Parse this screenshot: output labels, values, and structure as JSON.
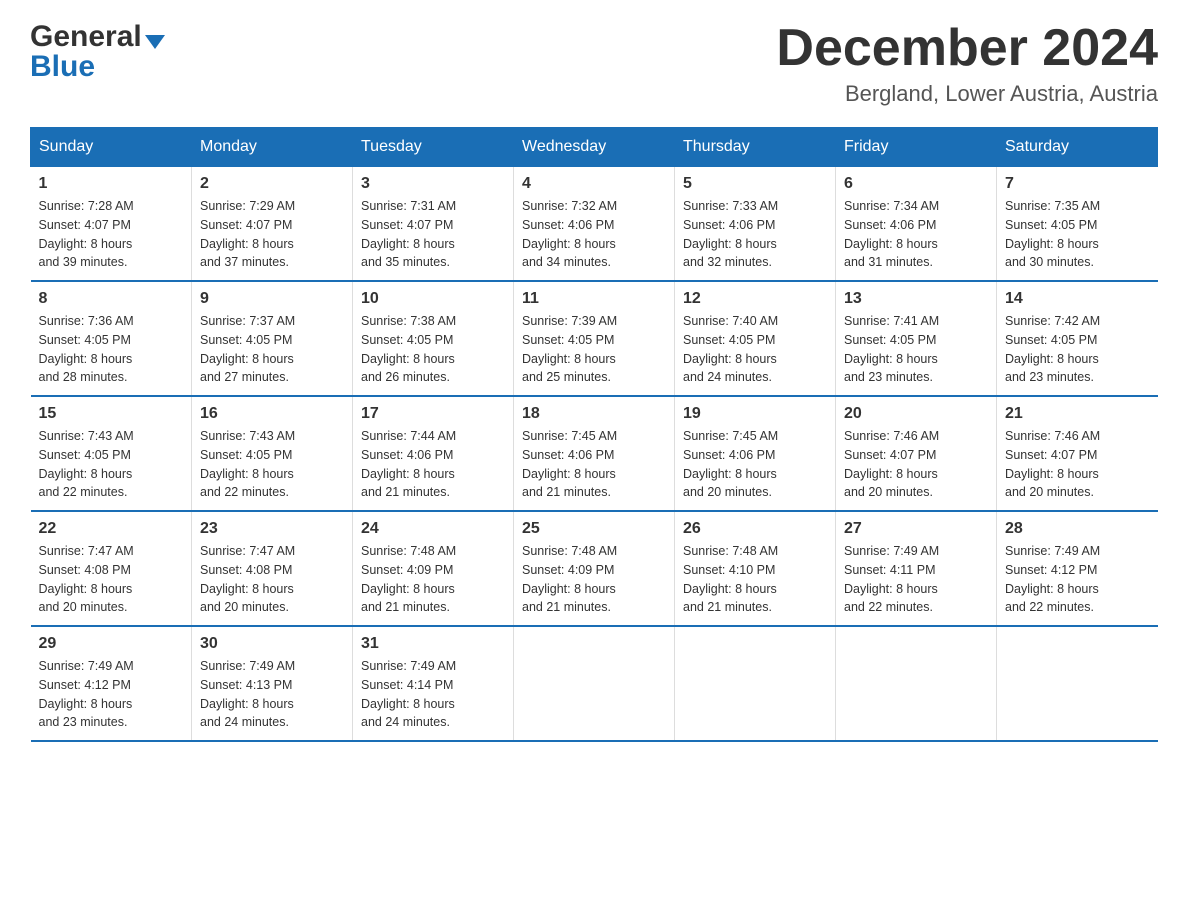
{
  "header": {
    "logo_top": "General",
    "logo_bottom": "Blue",
    "month_title": "December 2024",
    "location": "Bergland, Lower Austria, Austria"
  },
  "days_of_week": [
    "Sunday",
    "Monday",
    "Tuesday",
    "Wednesday",
    "Thursday",
    "Friday",
    "Saturday"
  ],
  "weeks": [
    [
      {
        "day": "1",
        "sunrise": "7:28 AM",
        "sunset": "4:07 PM",
        "daylight": "8 hours and 39 minutes."
      },
      {
        "day": "2",
        "sunrise": "7:29 AM",
        "sunset": "4:07 PM",
        "daylight": "8 hours and 37 minutes."
      },
      {
        "day": "3",
        "sunrise": "7:31 AM",
        "sunset": "4:07 PM",
        "daylight": "8 hours and 35 minutes."
      },
      {
        "day": "4",
        "sunrise": "7:32 AM",
        "sunset": "4:06 PM",
        "daylight": "8 hours and 34 minutes."
      },
      {
        "day": "5",
        "sunrise": "7:33 AM",
        "sunset": "4:06 PM",
        "daylight": "8 hours and 32 minutes."
      },
      {
        "day": "6",
        "sunrise": "7:34 AM",
        "sunset": "4:06 PM",
        "daylight": "8 hours and 31 minutes."
      },
      {
        "day": "7",
        "sunrise": "7:35 AM",
        "sunset": "4:05 PM",
        "daylight": "8 hours and 30 minutes."
      }
    ],
    [
      {
        "day": "8",
        "sunrise": "7:36 AM",
        "sunset": "4:05 PM",
        "daylight": "8 hours and 28 minutes."
      },
      {
        "day": "9",
        "sunrise": "7:37 AM",
        "sunset": "4:05 PM",
        "daylight": "8 hours and 27 minutes."
      },
      {
        "day": "10",
        "sunrise": "7:38 AM",
        "sunset": "4:05 PM",
        "daylight": "8 hours and 26 minutes."
      },
      {
        "day": "11",
        "sunrise": "7:39 AM",
        "sunset": "4:05 PM",
        "daylight": "8 hours and 25 minutes."
      },
      {
        "day": "12",
        "sunrise": "7:40 AM",
        "sunset": "4:05 PM",
        "daylight": "8 hours and 24 minutes."
      },
      {
        "day": "13",
        "sunrise": "7:41 AM",
        "sunset": "4:05 PM",
        "daylight": "8 hours and 23 minutes."
      },
      {
        "day": "14",
        "sunrise": "7:42 AM",
        "sunset": "4:05 PM",
        "daylight": "8 hours and 23 minutes."
      }
    ],
    [
      {
        "day": "15",
        "sunrise": "7:43 AM",
        "sunset": "4:05 PM",
        "daylight": "8 hours and 22 minutes."
      },
      {
        "day": "16",
        "sunrise": "7:43 AM",
        "sunset": "4:05 PM",
        "daylight": "8 hours and 22 minutes."
      },
      {
        "day": "17",
        "sunrise": "7:44 AM",
        "sunset": "4:06 PM",
        "daylight": "8 hours and 21 minutes."
      },
      {
        "day": "18",
        "sunrise": "7:45 AM",
        "sunset": "4:06 PM",
        "daylight": "8 hours and 21 minutes."
      },
      {
        "day": "19",
        "sunrise": "7:45 AM",
        "sunset": "4:06 PM",
        "daylight": "8 hours and 20 minutes."
      },
      {
        "day": "20",
        "sunrise": "7:46 AM",
        "sunset": "4:07 PM",
        "daylight": "8 hours and 20 minutes."
      },
      {
        "day": "21",
        "sunrise": "7:46 AM",
        "sunset": "4:07 PM",
        "daylight": "8 hours and 20 minutes."
      }
    ],
    [
      {
        "day": "22",
        "sunrise": "7:47 AM",
        "sunset": "4:08 PM",
        "daylight": "8 hours and 20 minutes."
      },
      {
        "day": "23",
        "sunrise": "7:47 AM",
        "sunset": "4:08 PM",
        "daylight": "8 hours and 20 minutes."
      },
      {
        "day": "24",
        "sunrise": "7:48 AM",
        "sunset": "4:09 PM",
        "daylight": "8 hours and 21 minutes."
      },
      {
        "day": "25",
        "sunrise": "7:48 AM",
        "sunset": "4:09 PM",
        "daylight": "8 hours and 21 minutes."
      },
      {
        "day": "26",
        "sunrise": "7:48 AM",
        "sunset": "4:10 PM",
        "daylight": "8 hours and 21 minutes."
      },
      {
        "day": "27",
        "sunrise": "7:49 AM",
        "sunset": "4:11 PM",
        "daylight": "8 hours and 22 minutes."
      },
      {
        "day": "28",
        "sunrise": "7:49 AM",
        "sunset": "4:12 PM",
        "daylight": "8 hours and 22 minutes."
      }
    ],
    [
      {
        "day": "29",
        "sunrise": "7:49 AM",
        "sunset": "4:12 PM",
        "daylight": "8 hours and 23 minutes."
      },
      {
        "day": "30",
        "sunrise": "7:49 AM",
        "sunset": "4:13 PM",
        "daylight": "8 hours and 24 minutes."
      },
      {
        "day": "31",
        "sunrise": "7:49 AM",
        "sunset": "4:14 PM",
        "daylight": "8 hours and 24 minutes."
      },
      {
        "day": "",
        "sunrise": "",
        "sunset": "",
        "daylight": ""
      },
      {
        "day": "",
        "sunrise": "",
        "sunset": "",
        "daylight": ""
      },
      {
        "day": "",
        "sunrise": "",
        "sunset": "",
        "daylight": ""
      },
      {
        "day": "",
        "sunrise": "",
        "sunset": "",
        "daylight": ""
      }
    ]
  ],
  "labels": {
    "sunrise_prefix": "Sunrise: ",
    "sunset_prefix": "Sunset: ",
    "daylight_prefix": "Daylight: "
  }
}
